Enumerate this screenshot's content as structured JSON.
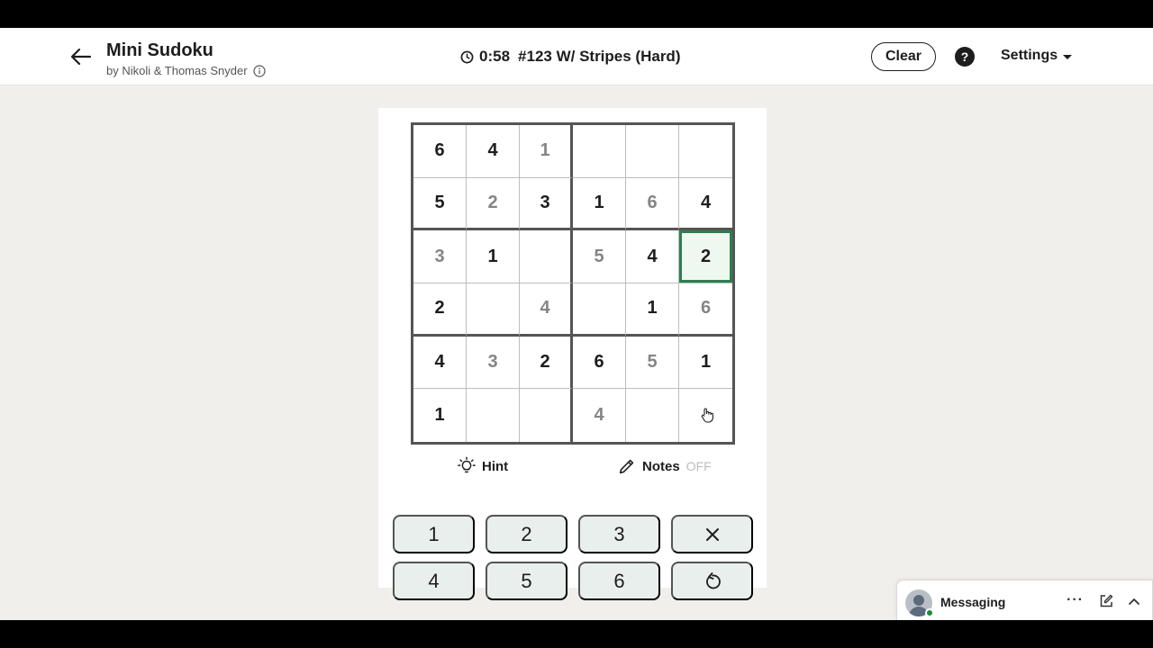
{
  "header": {
    "title": "Mini Sudoku",
    "byline": "by Nikoli & Thomas Snyder",
    "timer": "0:58",
    "puzzle_name": "#123 W/ Stripes (Hard)",
    "clear_label": "Clear",
    "help_label": "?",
    "settings_label": "Settings"
  },
  "grid": {
    "rows": [
      [
        {
          "v": "6",
          "t": "given"
        },
        {
          "v": "4",
          "t": "given"
        },
        {
          "v": "1",
          "t": "entered"
        },
        {
          "v": "",
          "t": "empty"
        },
        {
          "v": "",
          "t": "empty"
        },
        {
          "v": "",
          "t": "empty"
        }
      ],
      [
        {
          "v": "5",
          "t": "given"
        },
        {
          "v": "2",
          "t": "entered"
        },
        {
          "v": "3",
          "t": "given"
        },
        {
          "v": "1",
          "t": "given"
        },
        {
          "v": "6",
          "t": "entered"
        },
        {
          "v": "4",
          "t": "given"
        }
      ],
      [
        {
          "v": "3",
          "t": "entered"
        },
        {
          "v": "1",
          "t": "given"
        },
        {
          "v": "",
          "t": "empty"
        },
        {
          "v": "5",
          "t": "entered"
        },
        {
          "v": "4",
          "t": "given"
        },
        {
          "v": "2",
          "t": "given",
          "selected": true
        }
      ],
      [
        {
          "v": "2",
          "t": "given"
        },
        {
          "v": "",
          "t": "empty"
        },
        {
          "v": "4",
          "t": "entered"
        },
        {
          "v": "",
          "t": "empty"
        },
        {
          "v": "1",
          "t": "given"
        },
        {
          "v": "6",
          "t": "entered"
        }
      ],
      [
        {
          "v": "4",
          "t": "given"
        },
        {
          "v": "3",
          "t": "entered"
        },
        {
          "v": "2",
          "t": "given"
        },
        {
          "v": "6",
          "t": "given"
        },
        {
          "v": "5",
          "t": "entered"
        },
        {
          "v": "1",
          "t": "given"
        }
      ],
      [
        {
          "v": "1",
          "t": "given"
        },
        {
          "v": "",
          "t": "empty"
        },
        {
          "v": "",
          "t": "empty"
        },
        {
          "v": "4",
          "t": "entered"
        },
        {
          "v": "",
          "t": "empty"
        },
        {
          "v": "",
          "t": "empty"
        }
      ]
    ]
  },
  "tools": {
    "hint_label": "Hint",
    "notes_label": "Notes",
    "notes_state": "OFF"
  },
  "keypad": {
    "keys": [
      "1",
      "2",
      "3",
      "4",
      "5",
      "6"
    ]
  },
  "messaging": {
    "label": "Messaging",
    "more_label": "···"
  },
  "icons": {
    "back": "arrow-left-icon",
    "info": "info-icon",
    "clock": "clock-icon",
    "hint": "lightbulb-icon",
    "notes": "pencil-icon",
    "erase": "close-icon",
    "undo": "undo-icon"
  },
  "colors": {
    "selected_border": "#2f7d4f",
    "selected_fill": "#eef8f1",
    "key_bg": "#e9efec",
    "page_bg": "#f1efec"
  }
}
